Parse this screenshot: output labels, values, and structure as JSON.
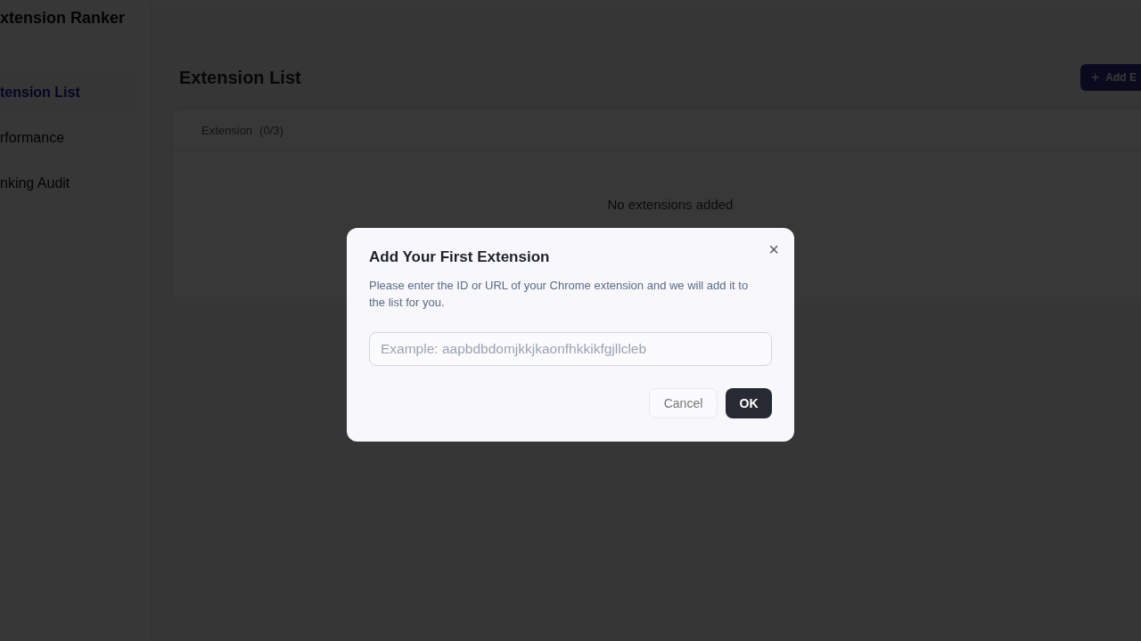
{
  "sidebar": {
    "title": "xtension Ranker",
    "items": [
      {
        "label": "tension List",
        "selected": true
      },
      {
        "label": "rformance",
        "selected": false
      },
      {
        "label": "nking Audit",
        "selected": false
      }
    ]
  },
  "main": {
    "title": "Extension List",
    "add_button": {
      "icon": "+",
      "label": "Add E"
    },
    "list": {
      "header": "Extension",
      "count": "(0/3)",
      "empty_text": "No extensions added"
    }
  },
  "dialog": {
    "title": "Add Your First Extension",
    "close": "×",
    "description": "Please enter the ID or URL of your Chrome extension and we will add it to the list for you.",
    "input": {
      "placeholder": "Example: aapbdbdomjkkjkaonfhkkikfgjllcleb"
    },
    "buttons": [
      {
        "label": "Cancel",
        "kind": "secondary"
      },
      {
        "label": "OK",
        "kind": "primary"
      }
    ]
  }
}
